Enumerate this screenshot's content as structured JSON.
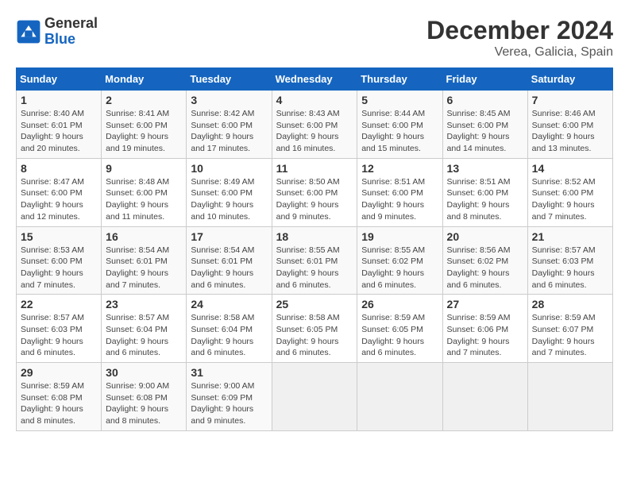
{
  "header": {
    "logo_line1": "General",
    "logo_line2": "Blue",
    "month": "December 2024",
    "location": "Verea, Galicia, Spain"
  },
  "weekdays": [
    "Sunday",
    "Monday",
    "Tuesday",
    "Wednesday",
    "Thursday",
    "Friday",
    "Saturday"
  ],
  "weeks": [
    [
      {
        "day": "1",
        "sunrise": "8:40 AM",
        "sunset": "6:01 PM",
        "daylight_hours": "9",
        "daylight_minutes": "20"
      },
      {
        "day": "2",
        "sunrise": "8:41 AM",
        "sunset": "6:00 PM",
        "daylight_hours": "9",
        "daylight_minutes": "19"
      },
      {
        "day": "3",
        "sunrise": "8:42 AM",
        "sunset": "6:00 PM",
        "daylight_hours": "9",
        "daylight_minutes": "17"
      },
      {
        "day": "4",
        "sunrise": "8:43 AM",
        "sunset": "6:00 PM",
        "daylight_hours": "9",
        "daylight_minutes": "16"
      },
      {
        "day": "5",
        "sunrise": "8:44 AM",
        "sunset": "6:00 PM",
        "daylight_hours": "9",
        "daylight_minutes": "15"
      },
      {
        "day": "6",
        "sunrise": "8:45 AM",
        "sunset": "6:00 PM",
        "daylight_hours": "9",
        "daylight_minutes": "14"
      },
      {
        "day": "7",
        "sunrise": "8:46 AM",
        "sunset": "6:00 PM",
        "daylight_hours": "9",
        "daylight_minutes": "13"
      }
    ],
    [
      {
        "day": "8",
        "sunrise": "8:47 AM",
        "sunset": "6:00 PM",
        "daylight_hours": "9",
        "daylight_minutes": "12"
      },
      {
        "day": "9",
        "sunrise": "8:48 AM",
        "sunset": "6:00 PM",
        "daylight_hours": "9",
        "daylight_minutes": "11"
      },
      {
        "day": "10",
        "sunrise": "8:49 AM",
        "sunset": "6:00 PM",
        "daylight_hours": "9",
        "daylight_minutes": "10"
      },
      {
        "day": "11",
        "sunrise": "8:50 AM",
        "sunset": "6:00 PM",
        "daylight_hours": "9",
        "daylight_minutes": "9"
      },
      {
        "day": "12",
        "sunrise": "8:51 AM",
        "sunset": "6:00 PM",
        "daylight_hours": "9",
        "daylight_minutes": "9"
      },
      {
        "day": "13",
        "sunrise": "8:51 AM",
        "sunset": "6:00 PM",
        "daylight_hours": "9",
        "daylight_minutes": "8"
      },
      {
        "day": "14",
        "sunrise": "8:52 AM",
        "sunset": "6:00 PM",
        "daylight_hours": "9",
        "daylight_minutes": "7"
      }
    ],
    [
      {
        "day": "15",
        "sunrise": "8:53 AM",
        "sunset": "6:00 PM",
        "daylight_hours": "9",
        "daylight_minutes": "7"
      },
      {
        "day": "16",
        "sunrise": "8:54 AM",
        "sunset": "6:01 PM",
        "daylight_hours": "9",
        "daylight_minutes": "7"
      },
      {
        "day": "17",
        "sunrise": "8:54 AM",
        "sunset": "6:01 PM",
        "daylight_hours": "9",
        "daylight_minutes": "6"
      },
      {
        "day": "18",
        "sunrise": "8:55 AM",
        "sunset": "6:01 PM",
        "daylight_hours": "9",
        "daylight_minutes": "6"
      },
      {
        "day": "19",
        "sunrise": "8:55 AM",
        "sunset": "6:02 PM",
        "daylight_hours": "9",
        "daylight_minutes": "6"
      },
      {
        "day": "20",
        "sunrise": "8:56 AM",
        "sunset": "6:02 PM",
        "daylight_hours": "9",
        "daylight_minutes": "6"
      },
      {
        "day": "21",
        "sunrise": "8:57 AM",
        "sunset": "6:03 PM",
        "daylight_hours": "9",
        "daylight_minutes": "6"
      }
    ],
    [
      {
        "day": "22",
        "sunrise": "8:57 AM",
        "sunset": "6:03 PM",
        "daylight_hours": "9",
        "daylight_minutes": "6"
      },
      {
        "day": "23",
        "sunrise": "8:57 AM",
        "sunset": "6:04 PM",
        "daylight_hours": "9",
        "daylight_minutes": "6"
      },
      {
        "day": "24",
        "sunrise": "8:58 AM",
        "sunset": "6:04 PM",
        "daylight_hours": "9",
        "daylight_minutes": "6"
      },
      {
        "day": "25",
        "sunrise": "8:58 AM",
        "sunset": "6:05 PM",
        "daylight_hours": "9",
        "daylight_minutes": "6"
      },
      {
        "day": "26",
        "sunrise": "8:59 AM",
        "sunset": "6:05 PM",
        "daylight_hours": "9",
        "daylight_minutes": "6"
      },
      {
        "day": "27",
        "sunrise": "8:59 AM",
        "sunset": "6:06 PM",
        "daylight_hours": "9",
        "daylight_minutes": "7"
      },
      {
        "day": "28",
        "sunrise": "8:59 AM",
        "sunset": "6:07 PM",
        "daylight_hours": "9",
        "daylight_minutes": "7"
      }
    ],
    [
      {
        "day": "29",
        "sunrise": "8:59 AM",
        "sunset": "6:08 PM",
        "daylight_hours": "9",
        "daylight_minutes": "8"
      },
      {
        "day": "30",
        "sunrise": "9:00 AM",
        "sunset": "6:08 PM",
        "daylight_hours": "9",
        "daylight_minutes": "8"
      },
      {
        "day": "31",
        "sunrise": "9:00 AM",
        "sunset": "6:09 PM",
        "daylight_hours": "9",
        "daylight_minutes": "9"
      },
      null,
      null,
      null,
      null
    ]
  ]
}
